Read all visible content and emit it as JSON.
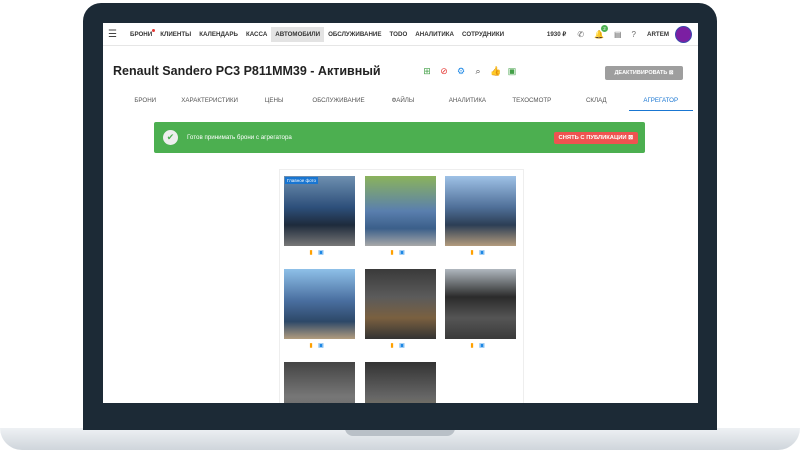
{
  "nav": {
    "items": [
      "БРОНИ",
      "КЛИЕНТЫ",
      "КАЛЕНДАРЬ",
      "КАССА",
      "АВТОМОБИЛИ",
      "ОБСЛУЖИВАНИЕ",
      "TODO",
      "АНАЛИТИКА",
      "СОТРУДНИКИ"
    ],
    "active": "АВТОМОБИЛИ",
    "price": "1930 ₽",
    "notification_count": "2",
    "user": "ARTEM"
  },
  "car": {
    "title": "Renault Sandero PC3 P811MM39 - Активный",
    "deactivate_label": "ДЕАКТИВИРОВАТЬ"
  },
  "tabs": [
    "БРОНИ",
    "ХАРАКТЕРИСТИКИ",
    "ЦЕНЫ",
    "ОБСЛУЖИВАНИЕ",
    "ФАЙЛЫ",
    "АНАЛИТИКА",
    "ТЕХОСМОТР",
    "СКЛАД",
    "АГРЕГАТОР"
  ],
  "active_tab": "АГРЕГАТОР",
  "banner": {
    "text": "Готов принимать брони с агрегатора",
    "unpublish_label": "СНЯТЬ С ПУБЛИКАЦИИ"
  },
  "gallery": {
    "main_photo_label": "Главное фото",
    "photos": [
      "front",
      "side",
      "rear",
      "rear-left",
      "trunk",
      "interior",
      "seats",
      "footwell"
    ]
  },
  "colors": {
    "accent": "#1976d2",
    "success": "#4caf50",
    "danger": "#ef5350",
    "warning": "#ffa000"
  }
}
